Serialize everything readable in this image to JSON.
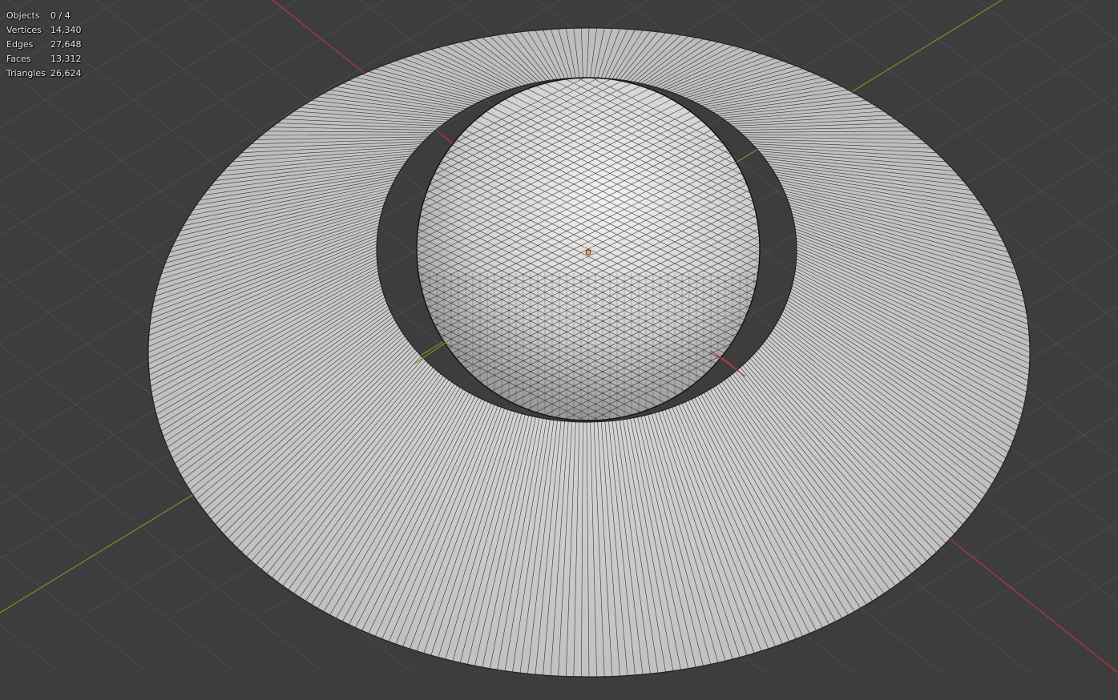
{
  "viewport": {
    "colors": {
      "background": "#3d3d3d",
      "grid": "#4c4c4c",
      "x_axis": "#a83a42",
      "y_axis": "#6b8f2a",
      "mesh_fill": "#c9c9c9",
      "wire": "#111111"
    },
    "origin_marker_icon": "object-origin-icon"
  },
  "stats": {
    "objects": {
      "label": "Objects",
      "value": "0 / 4"
    },
    "vertices": {
      "label": "Vertices",
      "value": "14,340"
    },
    "edges": {
      "label": "Edges",
      "value": "27,648"
    },
    "faces": {
      "label": "Faces",
      "value": "13,312"
    },
    "triangles": {
      "label": "Triangles",
      "value": "26,624"
    }
  }
}
